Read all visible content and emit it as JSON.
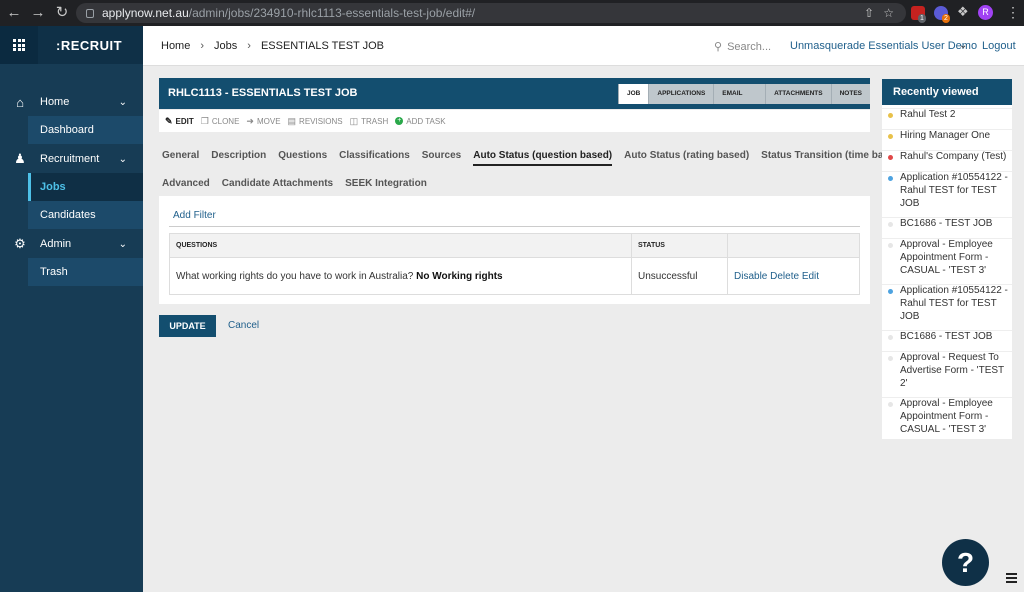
{
  "browser": {
    "url_domain": "applynow.net.au",
    "url_path": "/admin/jobs/234910-rhlc1113-essentials-test-job/edit#/",
    "profile_initial": "R"
  },
  "sidebar": {
    "logo": ":RECRUIT",
    "items": [
      {
        "label": "Home",
        "icon": "home-icon"
      },
      {
        "label": "Dashboard"
      },
      {
        "label": "Recruitment",
        "icon": "people-icon"
      },
      {
        "label": "Jobs"
      },
      {
        "label": "Candidates"
      },
      {
        "label": "Admin",
        "icon": "gear-icon"
      },
      {
        "label": "Trash"
      }
    ]
  },
  "topbar": {
    "breadcrumbs": [
      "Home",
      "Jobs",
      "ESSENTIALS TEST JOB"
    ],
    "search_placeholder": "Search...",
    "user": "Unmasquerade Essentials User Demo",
    "logout": "Logout"
  },
  "job": {
    "title": "RHLC1113 - ESSENTIALS TEST JOB",
    "tabs": [
      "JOB",
      "APPLICATIONS",
      "EMAIL STATUS",
      "ATTACHMENTS",
      "NOTES"
    ],
    "actions": [
      "EDIT",
      "CLONE",
      "MOVE",
      "REVISIONS",
      "TRASH",
      "ADD TASK"
    ],
    "section_tabs_row1": [
      "General",
      "Description",
      "Questions",
      "Classifications",
      "Sources",
      "Auto Status (question based)",
      "Auto Status (rating based)",
      "Status Transition (time based)"
    ],
    "section_tabs_row2": [
      "Advanced",
      "Candidate Attachments",
      "SEEK Integration"
    ],
    "add_filter": "Add Filter",
    "table": {
      "headers": [
        "QUESTIONS",
        "STATUS",
        ""
      ],
      "rows": [
        {
          "question": "What working rights do you have to work in Australia?",
          "answer": "No Working rights",
          "status": "Unsuccessful",
          "actions": [
            "Disable",
            "Delete",
            "Edit"
          ]
        }
      ]
    },
    "update": "UPDATE",
    "cancel": "Cancel"
  },
  "recent": {
    "title": "Recently viewed",
    "items": [
      {
        "label": "Rahul Test 2",
        "color": "#e8c14a"
      },
      {
        "label": "Hiring Manager One",
        "color": "#e8c14a"
      },
      {
        "label": "Rahul's Company (Test)",
        "color": "#e04848"
      },
      {
        "label": "Application #10554122 - Rahul TEST for TEST JOB",
        "color": "#4ea3e0"
      },
      {
        "label": "BC1686 - TEST JOB",
        "color": "#e6e6e6"
      },
      {
        "label": "Approval - Employee Appointment Form - CASUAL - 'TEST 3'",
        "color": "#e6e6e6"
      },
      {
        "label": "Application #10554122 - Rahul TEST for TEST JOB",
        "color": "#4ea3e0"
      },
      {
        "label": "BC1686 - TEST JOB",
        "color": "#e6e6e6"
      },
      {
        "label": "Approval - Request To Advertise Form - 'TEST 2'",
        "color": "#e6e6e6"
      },
      {
        "label": "Approval - Employee Appointment Form - CASUAL - 'TEST 3'",
        "color": "#e6e6e6"
      }
    ]
  },
  "help_label": "?"
}
